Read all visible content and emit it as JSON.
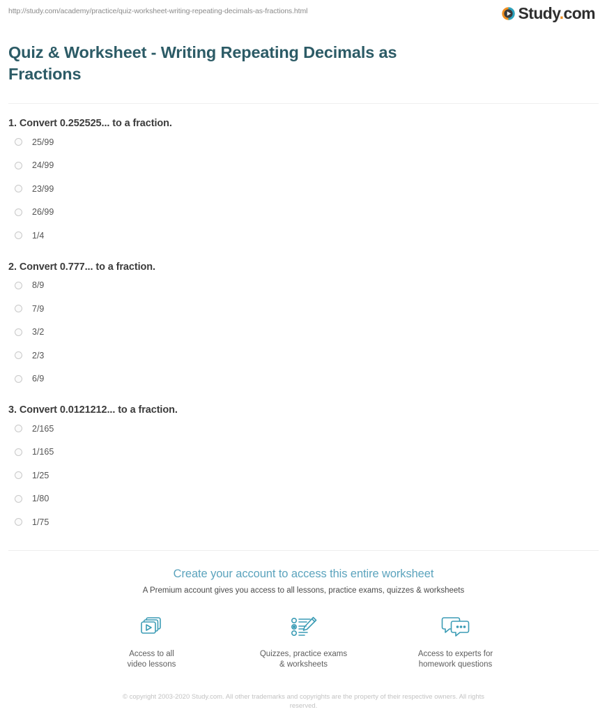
{
  "header": {
    "url": "http://study.com/academy/practice/quiz-worksheet-writing-repeating-decimals-as-fractions.html",
    "logo_text": "Study",
    "logo_dot": ".",
    "logo_domain": "com",
    "logo_icon": "play-circle-icon",
    "brand_teal": "#2aa3c0",
    "brand_orange": "#f08f20"
  },
  "page_title": "Quiz & Worksheet - Writing Repeating Decimals as Fractions",
  "questions": [
    {
      "text": "1. Convert 0.252525... to a fraction.",
      "options": [
        "25/99",
        "24/99",
        "23/99",
        "26/99",
        "1/4"
      ]
    },
    {
      "text": "2. Convert 0.777... to a fraction.",
      "options": [
        "8/9",
        "7/9",
        "3/2",
        "2/3",
        "6/9"
      ]
    },
    {
      "text": "3. Convert 0.0121212... to a fraction.",
      "options": [
        "2/165",
        "1/165",
        "1/25",
        "1/80",
        "1/75"
      ]
    }
  ],
  "promo": {
    "heading": "Create your account to access this entire worksheet",
    "subheading": "A Premium account gives you access to all lessons, practice exams, quizzes & worksheets",
    "accent_color": "#5ba3bd",
    "features": [
      {
        "icon": "video-lessons-icon",
        "label": "Access to all\nvideo lessons"
      },
      {
        "icon": "quiz-pencil-icon",
        "label": "Quizzes, practice exams\n& worksheets"
      },
      {
        "icon": "chat-bubbles-icon",
        "label": "Access to experts for\nhomework questions"
      }
    ]
  },
  "copyright": "© copyright 2003-2020 Study.com. All other trademarks and copyrights are the property of their respective owners. All rights reserved."
}
